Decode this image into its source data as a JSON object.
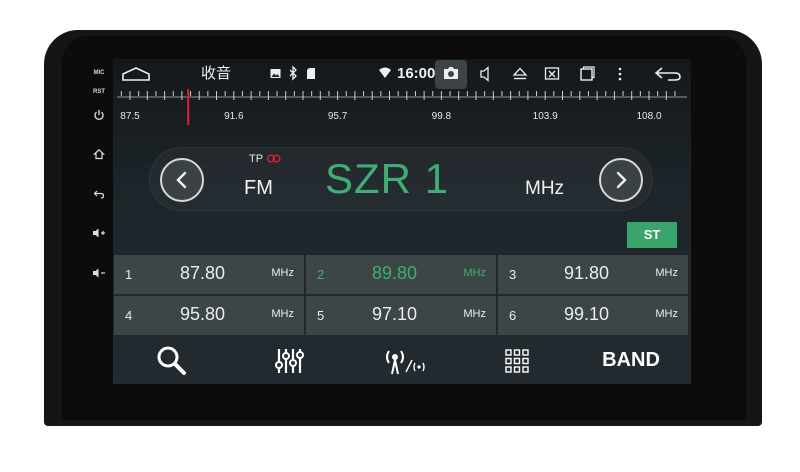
{
  "side_buttons": {
    "mic": "MIC",
    "rst": "RST",
    "icons": [
      "power-icon",
      "home-icon",
      "back-icon",
      "volume-up-icon",
      "volume-down-icon"
    ]
  },
  "status_bar": {
    "app_title": "收音",
    "time": "16:00",
    "icons": [
      "home-outline-icon",
      "image-icon",
      "bluetooth-icon",
      "sd-card-icon",
      "wifi-icon",
      "camera-icon",
      "volume-icon",
      "eject-icon",
      "close-window-icon",
      "recent-apps-icon",
      "more-icon",
      "return-icon"
    ]
  },
  "dial": {
    "labels": [
      "87.5",
      "91.6",
      "95.7",
      "99.8",
      "103.9",
      "108.0"
    ],
    "min": 87.5,
    "max": 108.0,
    "indicator": 89.8
  },
  "tuner": {
    "tp_label": "TP",
    "band_label": "FM",
    "station_name": "SZR 1",
    "unit": "MHz",
    "stereo_label": "ST",
    "colors": {
      "accent": "#3fae72",
      "stereo_bg": "#3aa56a",
      "indicator": "#d9232e"
    }
  },
  "presets": [
    {
      "num": "1",
      "freq": "87.80",
      "unit": "MHz",
      "selected": false
    },
    {
      "num": "2",
      "freq": "89.80",
      "unit": "MHz",
      "selected": true
    },
    {
      "num": "3",
      "freq": "91.80",
      "unit": "MHz",
      "selected": false
    },
    {
      "num": "4",
      "freq": "95.80",
      "unit": "MHz",
      "selected": false
    },
    {
      "num": "5",
      "freq": "97.10",
      "unit": "MHz",
      "selected": false
    },
    {
      "num": "6",
      "freq": "99.10",
      "unit": "MHz",
      "selected": false
    }
  ],
  "toolbar": {
    "icons": [
      "search-icon",
      "equalizer-icon",
      "broadcast-icon",
      "grid-icon"
    ],
    "band_label": "BAND"
  }
}
